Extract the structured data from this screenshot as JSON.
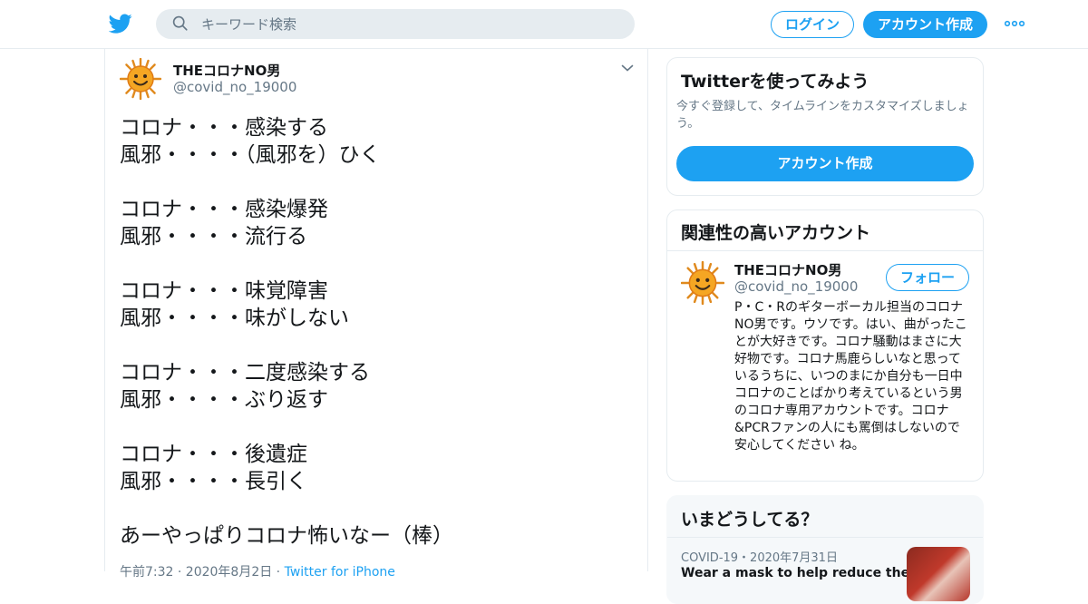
{
  "header": {
    "search_placeholder": "キーワード検索",
    "login_label": "ログイン",
    "signup_label": "アカウント作成",
    "brand_color": "#1da1f2"
  },
  "tweet": {
    "author_name": "THEコロナNO男",
    "author_handle": "@covid_no_19000",
    "text": "コロナ・・・感染する\n風邪・・・・（風邪を）ひく\n\nコロナ・・・感染爆発\n風邪・・・・流行る\n\nコロナ・・・味覚障害\n風邪・・・・味がしない\n\nコロナ・・・二度感染する\n風邪・・・・ぶり返す\n\nコロナ・・・後遺症\n風邪・・・・長引く\n\nあーやっぱりコロナ怖いなー（棒）",
    "time": "午前7:32 · 2020年8月2日 · ",
    "source": "Twitter for iPhone"
  },
  "signup_card": {
    "title": "Twitterを使ってみよう",
    "description": "今すぐ登録して、タイムラインをカスタマイズしましょう。",
    "button_label": "アカウント作成"
  },
  "related_card": {
    "title": "関連性の高いアカウント",
    "account": {
      "name": "THEコロナNO男",
      "handle": "@covid_no_19000",
      "follow_label": "フォロー",
      "bio": "P・C・Rのギターボーカル担当のコロナNO男です。ウソです。はい、曲がったことが大好きです。コロナ騒動はまさに大好物です。コロナ馬鹿らしいなと思っているうちに、いつのまにか自分も一日中コロナのことばかり考えているという男のコロナ専用アカウントです。コロナ&PCRファンの人にも罵倒はしないので安心してください ね。"
    }
  },
  "trends_card": {
    "title": "いまどうしてる？",
    "trend_meta": "COVID-19・2020年7月31日",
    "trend_title": "Wear a mask to help reduce the"
  }
}
